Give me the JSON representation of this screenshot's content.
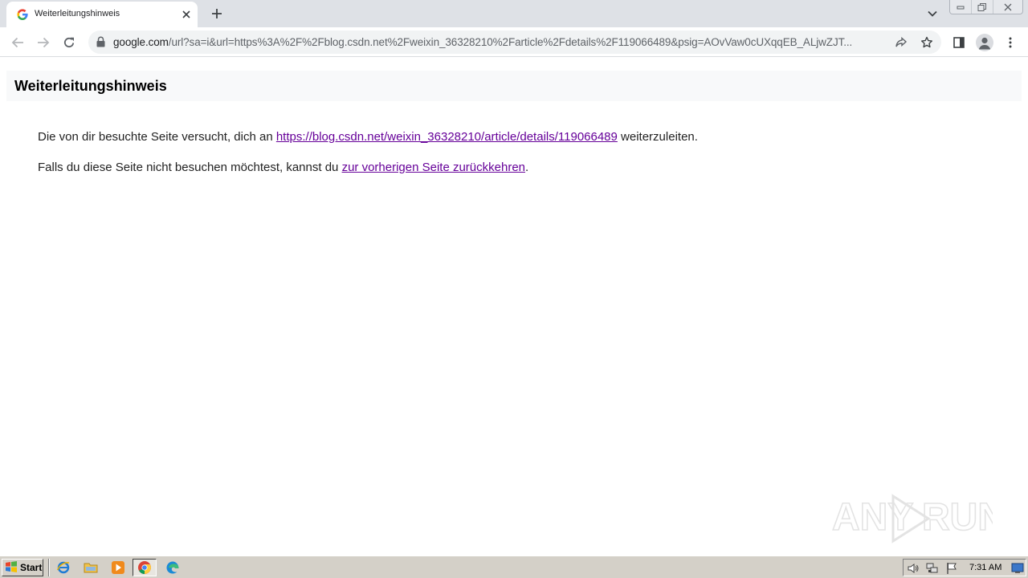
{
  "browser": {
    "tab": {
      "title": "Weiterleitungshinweis",
      "favicon": "google-g-icon"
    },
    "url": {
      "host": "google.com",
      "path": "/url?sa=i&url=https%3A%2F%2Fblog.csdn.net%2Fweixin_36328210%2Farticle%2Fdetails%2F119066489&psig=AOvVaw0cUXqqEB_ALjwZJT..."
    },
    "icons": {
      "back": "back-arrow-icon",
      "forward": "forward-arrow-icon",
      "reload": "reload-icon",
      "lock": "lock-icon",
      "share": "share-icon",
      "bookmark": "star-icon",
      "side_panel": "side-panel-icon",
      "profile": "profile-icon",
      "menu": "kebab-menu-icon"
    }
  },
  "page": {
    "heading": "Weiterleitungshinweis",
    "line1": {
      "before": "Die von dir besuchte Seite versucht, dich an ",
      "link": "https://blog.csdn.net/weixin_36328210/article/details/119066489",
      "after": " weiterzuleiten."
    },
    "line2": {
      "before": "Falls du diese Seite nicht besuchen möchtest, kannst du ",
      "link": "zur vorherigen Seite zurückkehren",
      "after": "."
    },
    "watermark": "ANY RUN"
  },
  "taskbar": {
    "start_label": "Start",
    "clock": "7:31 AM",
    "quicklaunch": [
      "internet-explorer-icon",
      "folder-icon",
      "media-player-icon",
      "chrome-icon",
      "edge-icon"
    ]
  },
  "colors": {
    "visited_link": "#660099",
    "tabstrip": "#dee1e6",
    "heading_bar": "#f8f9fa",
    "taskbar": "#d4d0c8"
  }
}
